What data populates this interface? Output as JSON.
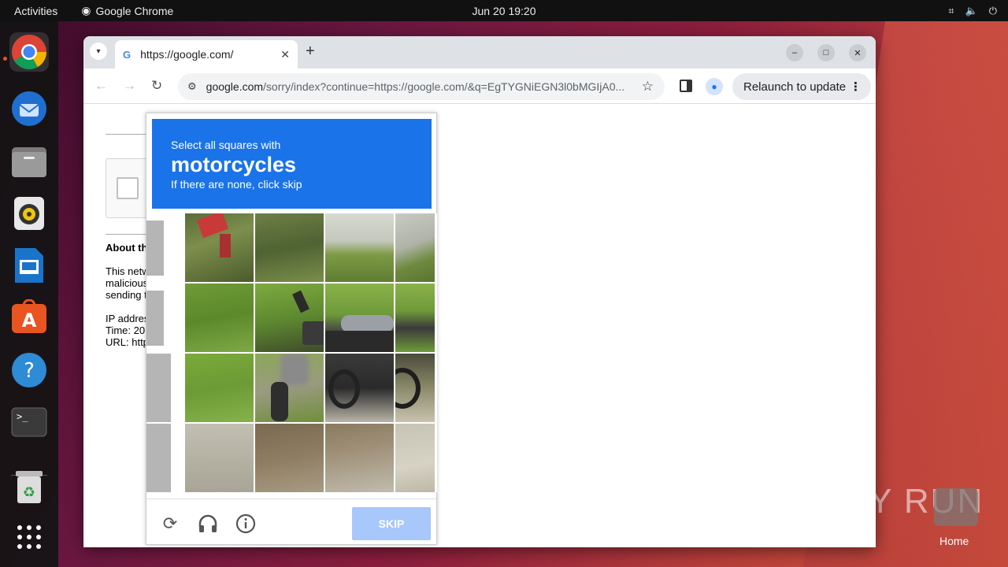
{
  "topbar": {
    "activities": "Activities",
    "app_name": "Google Chrome",
    "clock": "Jun 20  19:20"
  },
  "browser": {
    "tab_title": "https://google.com/",
    "tab_favicon": "G",
    "url_host": "google.com",
    "url_path": "/sorry/index?continue=https://google.com/&q=EgTYGNiEGN3l0bMGIjA0...",
    "relaunch_label": "Relaunch to update"
  },
  "page": {
    "about_heading": "About th",
    "para_lines": [
      "This netw",
      "malicious",
      "sending t"
    ],
    "info_lines": [
      "IP addres",
      "Time: 20",
      "URL: http"
    ]
  },
  "captcha": {
    "line1": "Select all squares with",
    "target": "motorcycles",
    "line3": "If there are none, click skip",
    "skip_label": "SKIP"
  },
  "desktop": {
    "watermark": "ANY RUN",
    "home_label": "Home"
  },
  "colors": {
    "captcha_blue": "#1a73e8",
    "skip_disabled": "#a8c7fa",
    "ubuntu_orange": "#e95420"
  }
}
